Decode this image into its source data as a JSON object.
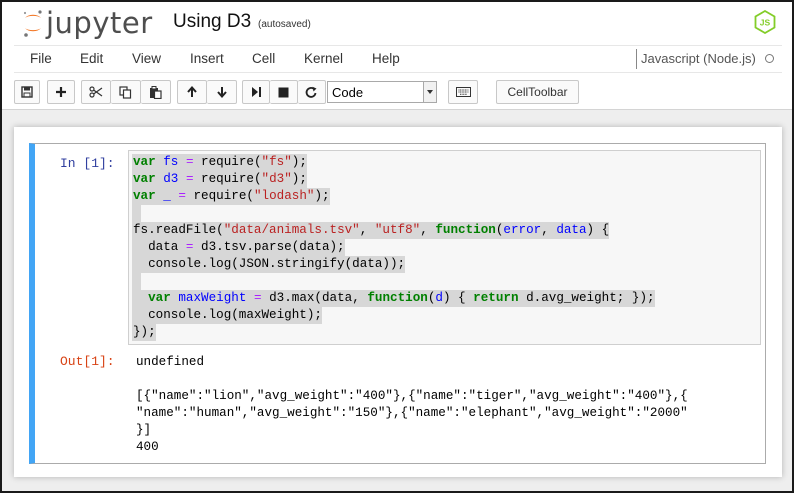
{
  "header": {
    "logo_text": "jupyter",
    "notebook_name": "Using D3",
    "autosave_status": "(autosaved)",
    "kernel_logo_text": "JS"
  },
  "menu": {
    "items": [
      "File",
      "Edit",
      "View",
      "Insert",
      "Cell",
      "Kernel",
      "Help"
    ],
    "kernel_name": "Javascript (Node.js)"
  },
  "toolbar": {
    "cell_type": "Code",
    "cell_type_options": [
      "Code"
    ],
    "celltoolbar_label": "CellToolbar",
    "buttons": [
      "save-icon",
      "plus-icon",
      "cut-icon",
      "copy-icon",
      "paste-icon",
      "arrow-up-icon",
      "arrow-down-icon",
      "run-icon",
      "stop-icon",
      "restart-icon",
      "keyboard-icon"
    ]
  },
  "cell": {
    "in_prompt": "In [1]:",
    "out_prompt": "Out[1]:",
    "code_lines": [
      "var fs = require(\"fs\");",
      "var d3 = require(\"d3\");",
      "var _ = require(\"lodash\");",
      "",
      "fs.readFile(\"data/animals.tsv\", \"utf8\", function(error, data) {",
      "  data = d3.tsv.parse(data);",
      "  console.log(JSON.stringify(data));",
      "",
      "  var maxWeight = d3.max(data, function(d) { return d.avg_weight; });",
      "  console.log(maxWeight);",
      "});"
    ],
    "output_lines": [
      "undefined",
      "",
      "[{\"name\":\"lion\",\"avg_weight\":\"400\"},{\"name\":\"tiger\",\"avg_weight\":\"400\"},{",
      "\"name\":\"human\",\"avg_weight\":\"150\"},{\"name\":\"elephant\",\"avg_weight\":\"2000\"",
      "}]",
      "400"
    ]
  },
  "colors": {
    "cell_border_active": "#42a5f5",
    "in_prompt": "#303f9f",
    "out_prompt": "#d84315",
    "keyword": "#008000",
    "string": "#ba2121",
    "variable": "#0000ff",
    "logo_orange": "#f37726"
  }
}
